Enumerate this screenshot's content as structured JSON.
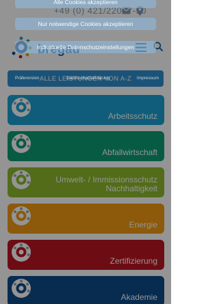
{
  "header": {
    "phone": "+49 (0) 421/22097-50",
    "mail_icon": "mail-icon",
    "location_icon": "location-pin-icon",
    "logo_text": "bregau",
    "menu_icon": "hamburger-menu-icon",
    "search_icon": "search-icon"
  },
  "main": {
    "az_button_label": "ALLE LEISTUNGEN VON A-Z",
    "services": [
      {
        "label": "Arbeitsschutz",
        "color": "#1aa0d2"
      },
      {
        "label": "Abfallwirtschaft",
        "color": "#0f9d74"
      },
      {
        "label": "Umwelt- / Immissionsschutz Nachhaltigkeit",
        "color": "#8dbb2d"
      },
      {
        "label": "Energie",
        "color": "#f29b12"
      },
      {
        "label": "Zertifizierung",
        "color": "#be1622"
      },
      {
        "label": "Akademie",
        "color": "#0f4b8a"
      }
    ]
  },
  "cookie_dialog": {
    "accept_all": "Alle Cookies akzeptieren",
    "necessary_only": "Nur notwendige Cookies akzeptieren",
    "individual_settings": "Individuelle Datenschutzeinstellungen",
    "tabs": [
      "Präferenzen",
      "Datenschutzerklärung",
      "Impressum"
    ]
  }
}
